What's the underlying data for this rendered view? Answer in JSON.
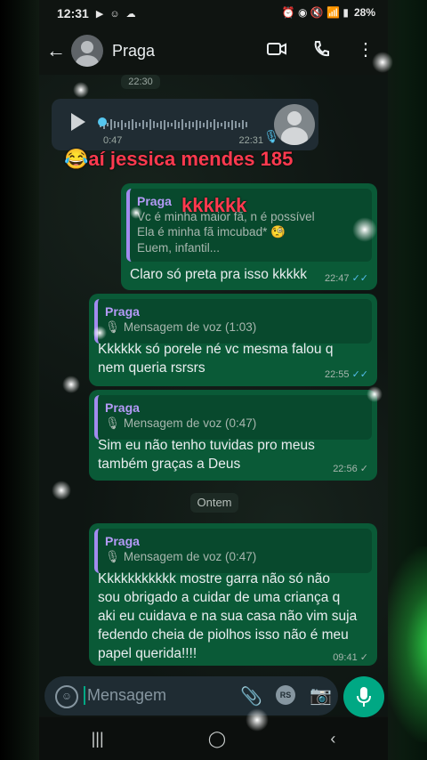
{
  "status": {
    "time": "12:31",
    "left_icons": "▶ ☺ ☁",
    "right_icons": "⏰ ◉ 🔇 📶 ▮",
    "battery": "28%"
  },
  "chat": {
    "contact": "Praga"
  },
  "messages": {
    "time_pill": "22:30",
    "voice": {
      "duration": "0:47",
      "time": "22:31"
    },
    "overlay_text_1": "😂aí jessica mendes 185",
    "overlay_text_2": "kkkkkk",
    "m1": {
      "quote_name": "Praga",
      "quote_line1": "Vc é minha maior fã, n é possível",
      "quote_line2": "Ela é minha fã imcubad* 🧐",
      "quote_line3": "Euem, infantil...",
      "text": "Claro só preta pra isso kkkkk",
      "time": "22:47",
      "ticks": "✓✓"
    },
    "m2": {
      "quote_name": "Praga",
      "quote_line1": "🎙 Mensagem de voz (1:03)",
      "text_line1": "Kkkkkk só porele né vc mesma falou q",
      "text_line2": "nem queria rsrsrs",
      "time": "22:55",
      "ticks": "✓✓"
    },
    "m3": {
      "quote_name": "Praga",
      "quote_line1": "🎙 Mensagem de voz (0:47)",
      "text_line1": "Sim eu não tenho tuvidas pro meus",
      "text_line2": "também graças a Deus",
      "time": "22:56",
      "ticks": "✓"
    },
    "date_pill": "Ontem",
    "m4": {
      "quote_name": "Praga",
      "quote_line1": "🎙 Mensagem de voz (0:47)",
      "text_line1": "Kkkkkkkkkkk mostre garra não só não",
      "text_line2": "sou obrigado a cuidar de uma criança q",
      "text_line3": "aki eu cuidava e na sua casa não vim suja",
      "text_line4": "fedendo cheia de piolhos isso não é meu",
      "text_line5": "papel querida!!!!",
      "time": "09:41",
      "ticks": "✓"
    }
  },
  "composer": {
    "placeholder": "Mensagem",
    "rs_label": "RS"
  },
  "nav": {
    "recents": "|||",
    "home": "◯",
    "back": "‹"
  }
}
